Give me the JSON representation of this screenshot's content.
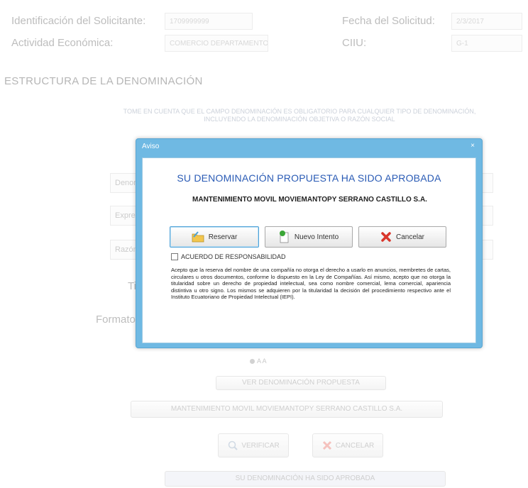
{
  "form": {
    "solicitante_label": "Identificación del Solicitante:",
    "solicitante_value": "1709999999",
    "fecha_label": "Fecha del Solicitud:",
    "fecha_value": "2/3/2017",
    "actividad_label": "Actividad Económica:",
    "actividad_value": "COMERCIO DEPARTAMENTO",
    "ciiu_label": "CIIU:",
    "ciiu_value": "G-1"
  },
  "section": {
    "title": "ESTRUCTURA DE LA DENOMINACIÓN",
    "note": "TOME EN CUENTA QUE EL CAMPO DENOMINACIÓN ES OBLIGATORIO PARA CUALQUIER TIPO DE DENOMINACIÓN, INCLUYENDO LA DENOMINACIÓN OBJETIVA O RAZÓN SOCIAL",
    "row1_label": "Denom",
    "row2_label": "Expre",
    "row3_label": "Razón",
    "tipo_label": "Ti",
    "formato_label": "Formato",
    "radio_option": "A A",
    "ver_button": "VER DENOMINACIÓN PROPUESTA",
    "proposed_name": "MANTENIMIENTO MOVIL MOVIEMANTOPY SERRANO CASTILLO S.A.",
    "verificar_button": "VERIFICAR",
    "cancelar_button": "CANCELAR",
    "footer_status": "SU DENOMINACIÓN HA SIDO APROBADA"
  },
  "dialog": {
    "title": "Aviso",
    "approved_message": "SU DENOMINACIÓN PROPUESTA HA SIDO APROBADA",
    "company_name": "MANTENIMIENTO MOVIL MOVIEMANTOPY SERRANO CASTILLO S.A.",
    "reservar_label": "Reservar",
    "nuevo_label": "Nuevo Intento",
    "cancelar_label": "Cancelar",
    "checkbox_label": "ACUERDO DE RESPONSABILIDAD",
    "legal_text": "Acepto que la reserva del nombre de una compañía no otorga el derecho a usarlo en anuncios, membretes de cartas, circulares u otros documentos, conforme lo dispuesto en la Ley de Compañías. Así mismo, acepto que no otorga la titularidad sobre un derecho de propiedad intelectual, sea como nombre comercial, lema comercial, apariencia distintiva u otro signo. Los mismos se adquieren por la titularidad la decisión del procedimiento respectivo ante el Instituto Ecuatoriano de Propiedad Intelectual (IEPI)."
  },
  "colors": {
    "dialog_frame": "#6fb9e3",
    "approved_text": "#2a5bb5",
    "cancel_icon": "#d9362b",
    "new_icon": "#3aa636"
  },
  "icons": {
    "reservar": "save-folder-icon",
    "nuevo": "refresh-document-icon",
    "cancelar": "cancel-x-icon",
    "verificar": "magnifier-icon",
    "close": "close-icon"
  }
}
